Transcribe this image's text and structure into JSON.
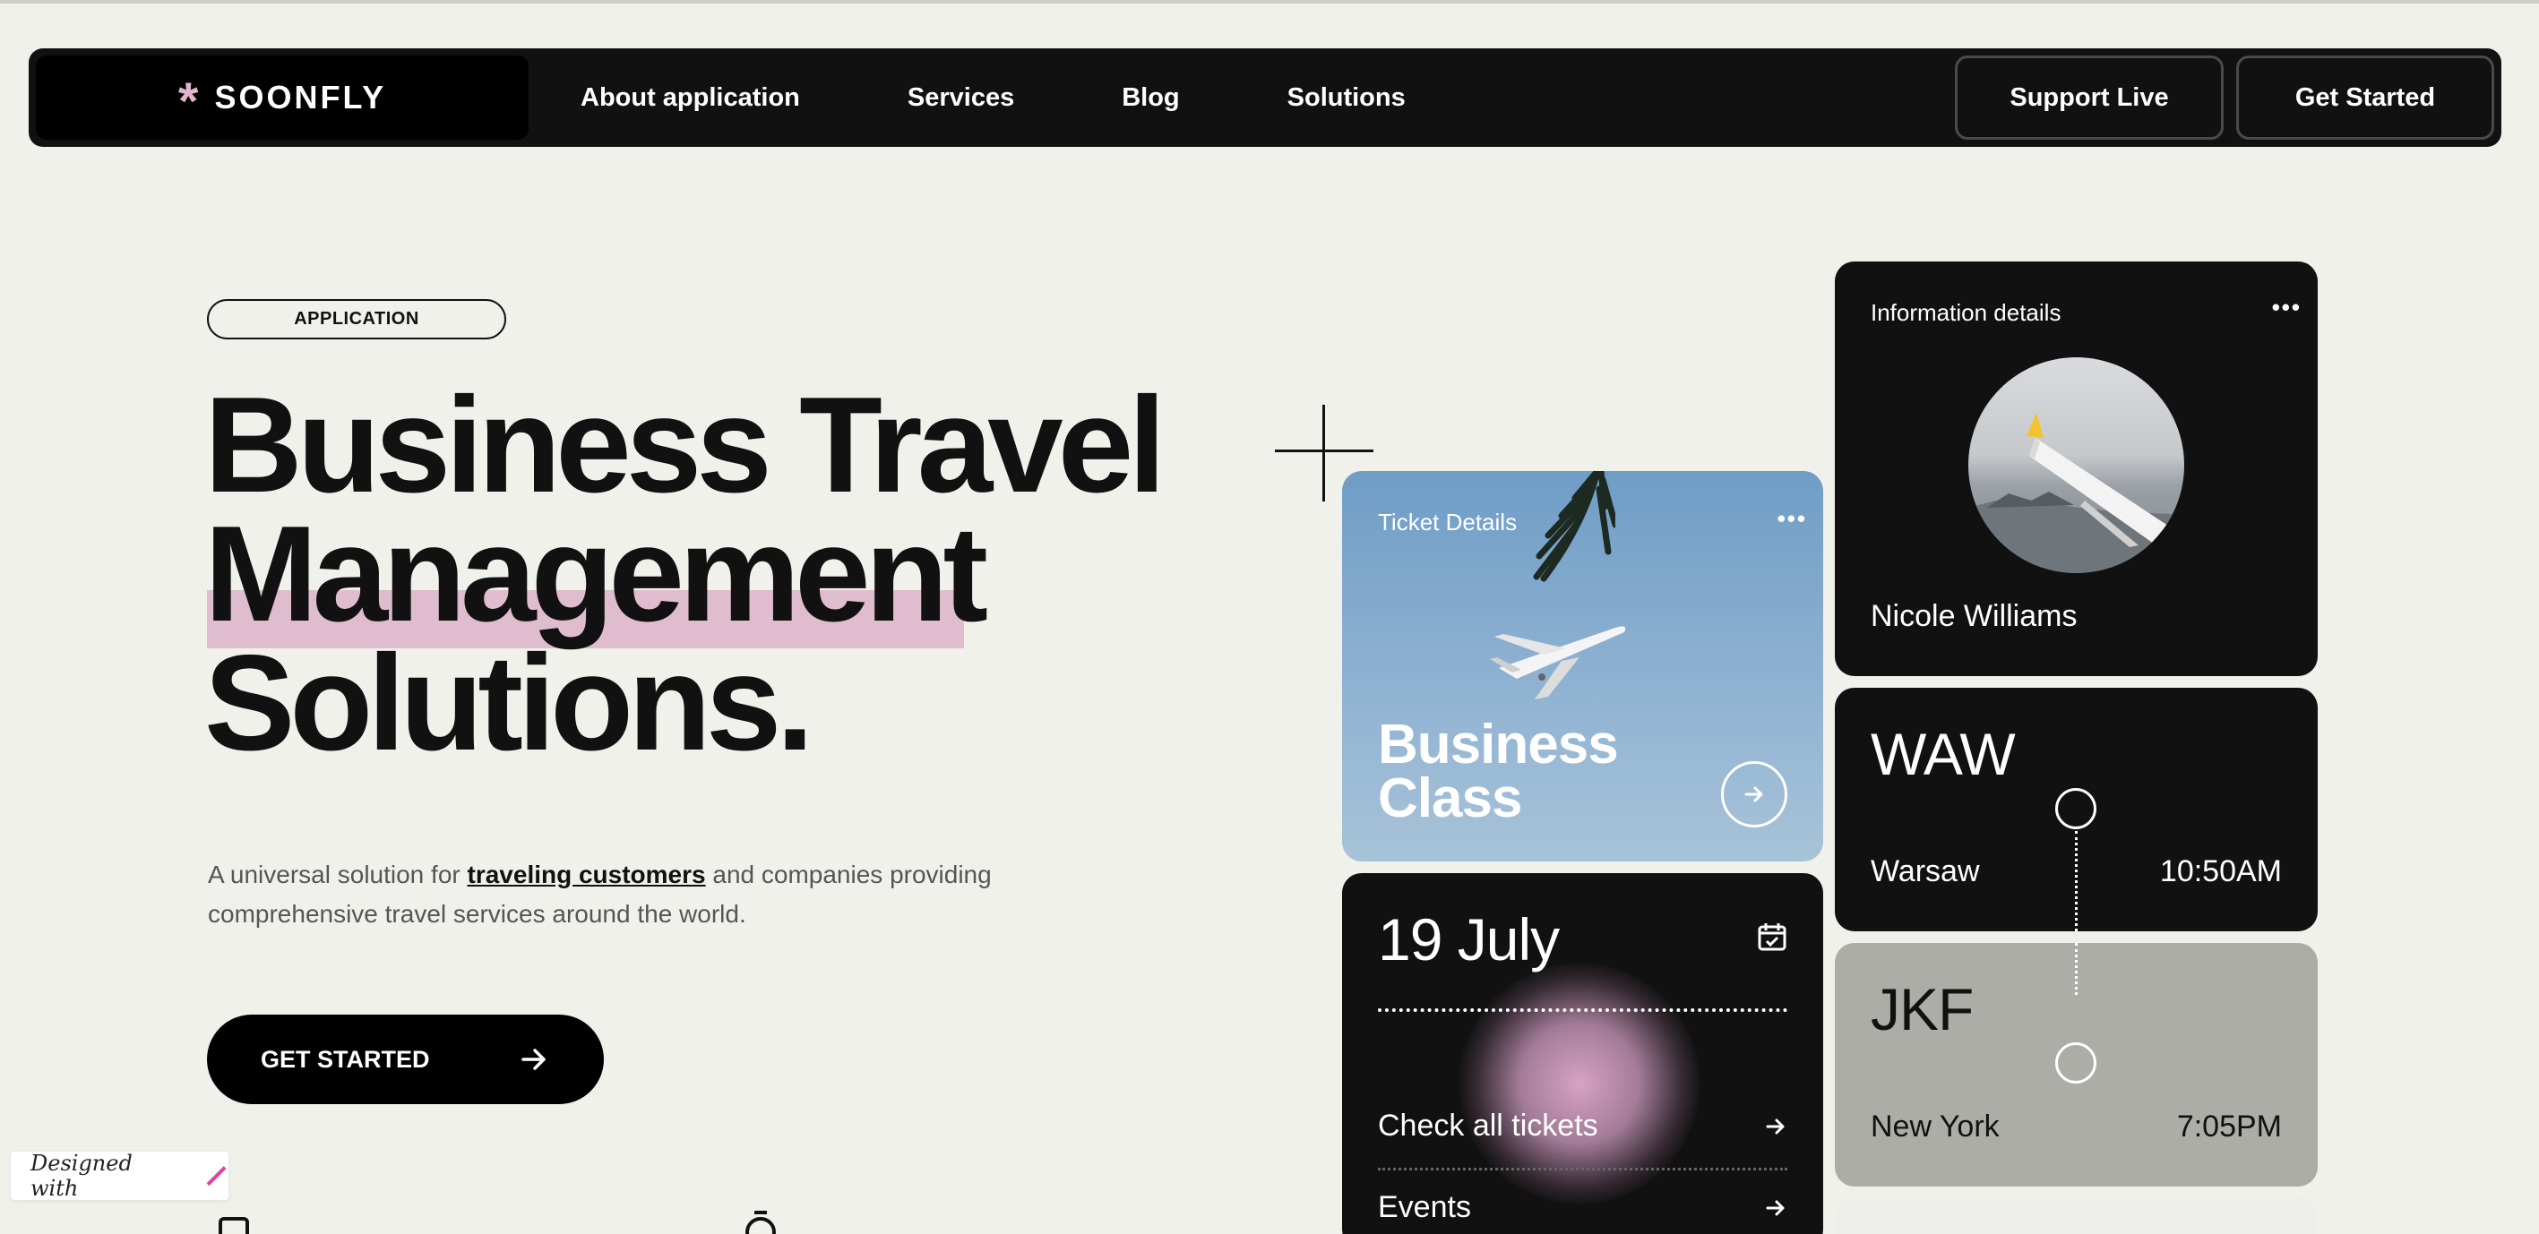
{
  "nav": {
    "logo_icon": "asterisk-icon",
    "logo_text": "SOONFLY",
    "links": [
      "About application",
      "Services",
      "Blog",
      "Solutions"
    ],
    "support_label": "Support Live",
    "get_started_label": "Get Started"
  },
  "hero": {
    "pill": "APPLICATION",
    "title_line1": "Business Travel",
    "title_line2": "Management",
    "title_line3": "Solutions.",
    "desc_before": "A universal solution for ",
    "desc_strong": "traveling customers",
    "desc_after": " and companies providing comprehensive travel services around the world.",
    "cta_label": "GET STARTED"
  },
  "badge": {
    "label": "Designed with"
  },
  "ticket_card": {
    "label": "Ticket Details",
    "title": "Business Class"
  },
  "date_card": {
    "date": "19 July",
    "link1": "Check all tickets",
    "link2": "Events"
  },
  "info_card": {
    "label": "Information details",
    "name": "Nicole Williams"
  },
  "departure": {
    "code": "WAW",
    "city": "Warsaw",
    "time": "10:50AM"
  },
  "arrival": {
    "code": "JKF",
    "city": "New York",
    "time": "7:05PM"
  },
  "colors": {
    "background": "#f1f1ec",
    "dark": "#111111",
    "accent_pink": "#e0bccf",
    "sky_blue": "#8fb2d2",
    "gray_card": "#adada7"
  }
}
